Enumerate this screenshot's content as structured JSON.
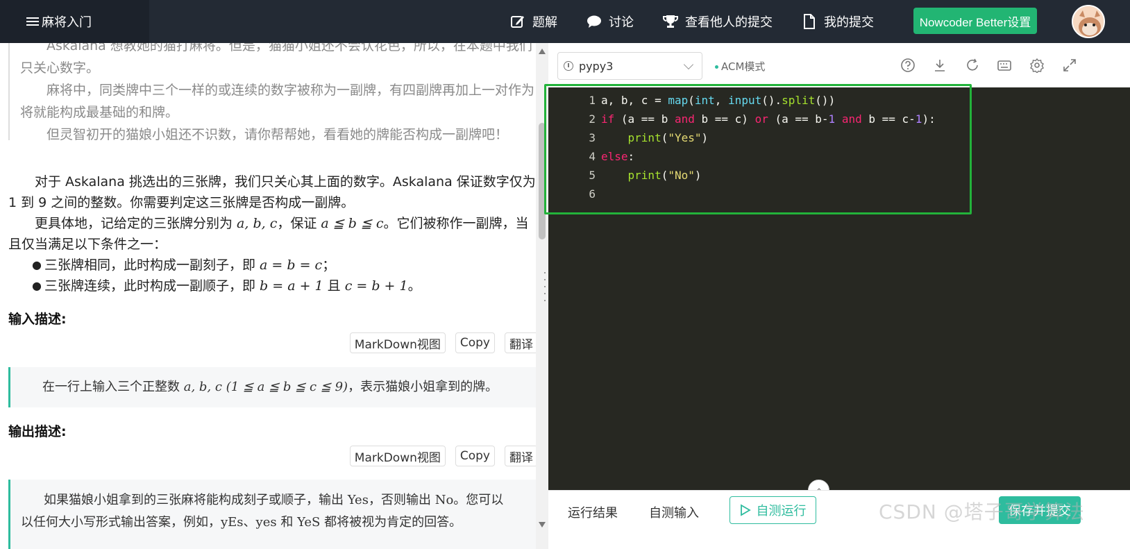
{
  "header": {
    "brand": "麻将入门",
    "nav": [
      {
        "label": "题解",
        "icon": "edit-icon"
      },
      {
        "label": "讨论",
        "icon": "chat-icon"
      },
      {
        "label": "查看他人的提交",
        "icon": "trophy-icon"
      },
      {
        "label": "我的提交",
        "icon": "file-icon"
      }
    ],
    "better_button": "Nowcoder Better设置"
  },
  "problem": {
    "quote_lines": [
      "Askalana 想教她的猫打麻将。但是，猫猫小姐还不会认花色，所以，在本题中我们只关心数字。",
      "麻将中，同类牌中三个一样的或连续的数字被称为一副牌，有四副牌再加上一对作为将就能构成最基础的和牌。",
      "但灵智初开的猫娘小姐还不识数，请你帮帮她，看看她的牌能否构成一副牌吧！"
    ],
    "para1": "对于 Askalana 挑选出的三张牌，我们只关心其上面的数字。Askalana 保证数字仅为 1 到 9 之间的整数。你需要判定这三张牌是否构成一副牌。",
    "para2_prefix": "更具体地，记给定的三张牌分别为 ",
    "para2_math1": "a, b, c",
    "para2_mid": "，保证 ",
    "para2_math2": "a ≦ b ≦ c",
    "para2_suffix": "。它们被称作一副牌，当且仅当满足以下条件之一：",
    "bullet1_text": "三张牌相同，此时构成一副刻子，即 ",
    "bullet1_math": "a = b = c",
    "bullet1_end": "；",
    "bullet2_text": "三张牌连续，此时构成一副顺子，即 ",
    "bullet2_math1": "b = a + 1",
    "bullet2_mid": " 且 ",
    "bullet2_math2": "c = b + 1",
    "bullet2_end": "。",
    "input_title": "输入描述:",
    "input_text_prefix": "在一行上输入三个正整数 ",
    "input_math": "a, b, c (1 ≦ a ≦ b ≦ c ≦ 9)",
    "input_text_suffix": "，表示猫娘小姐拿到的牌。",
    "output_title": "输出描述:",
    "output_line1_a": "如果猫娘小姐拿到的三张麻将能构成刻子或顺子，输出 ",
    "output_yes": "Yes",
    "output_line1_b": "，否则输出 ",
    "output_no": "No",
    "output_line1_c": "。您可以",
    "output_line2_a": "以任何大小写形式输出答案，例如，",
    "output_line2_b": "yEs",
    "output_line2_c": "、",
    "output_line2_d": "yes",
    "output_line2_e": " 和 ",
    "output_line2_f": "YeS",
    "output_line2_g": " 都将被视为肯定的回答。",
    "buttons": {
      "markdown": "MarkDown视图",
      "copy": "Copy",
      "translate": "翻译"
    }
  },
  "editor": {
    "language": "pypy3",
    "mode": "ACM模式",
    "line_numbers": [
      "1",
      "2",
      "3",
      "4",
      "5",
      "6"
    ]
  },
  "bottom": {
    "tab_result": "运行结果",
    "tab_input": "自测输入",
    "run_button": "自测运行",
    "submit_button": "保存并提交"
  },
  "watermark": "CSDN @塔子哥学算法",
  "colors": {
    "accent": "#2ebc9e",
    "highlight_box": "#22b33a",
    "topbar": "#232a34",
    "editor_bg": "#272822"
  }
}
